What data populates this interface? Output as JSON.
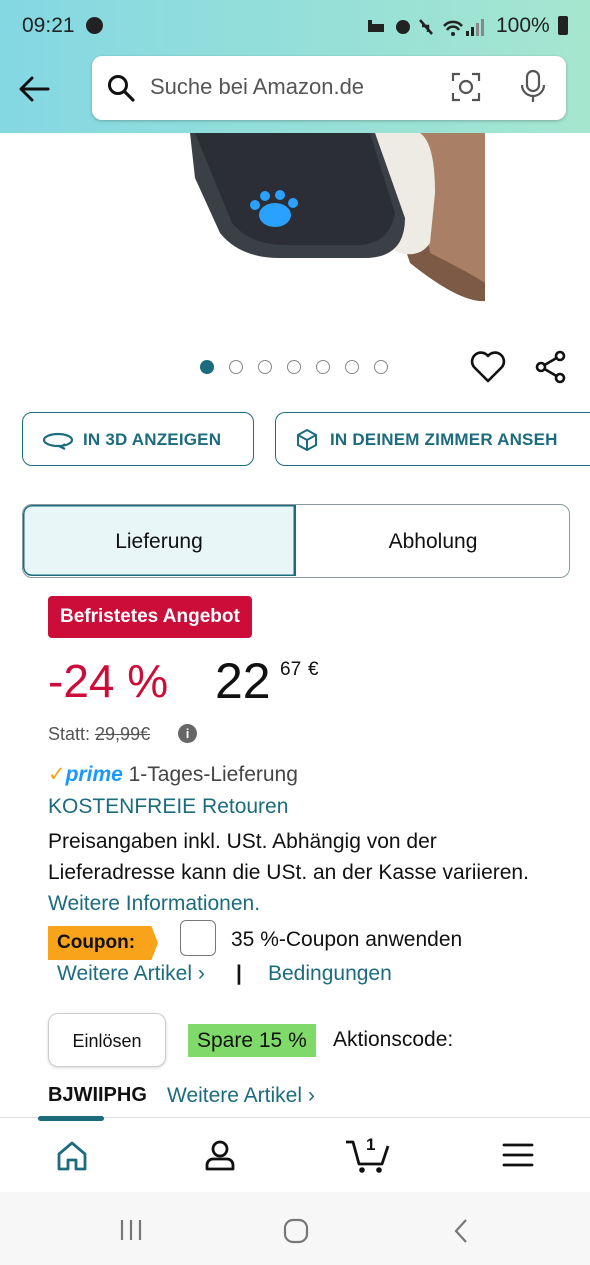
{
  "status_bar": {
    "time": "09:21",
    "battery": "100%"
  },
  "search": {
    "placeholder": "Suche bei Amazon.de"
  },
  "gallery": {
    "image_count": 7,
    "active_index": 0
  },
  "view_buttons": {
    "view_3d": "IN 3D ANZEIGEN",
    "view_room": "IN DEINEM ZIMMER ANSEH"
  },
  "delivery_tabs": {
    "delivery": "Lieferung",
    "pickup": "Abholung"
  },
  "deal": {
    "badge": "Befristetes Angebot",
    "discount": "-24 %",
    "price_whole": "22",
    "price_fraction": "67",
    "currency": "€",
    "was_label": "Statt: ",
    "was_price": "29,99€"
  },
  "shipping": {
    "prime": "prime",
    "prime_delivery": " 1-Tages-Lieferung",
    "returns": "KOSTENFREIE Retouren",
    "tax_note": "Preisangaben inkl. USt. Abhängig von der Lieferadresse kann die USt. an der Kasse variieren. ",
    "more_info": "Weitere Informationen."
  },
  "coupon": {
    "tag": "Coupon:",
    "apply_label": "35 %-Coupon anwenden",
    "more_items": "Weitere Artikel ›",
    "separator": "|",
    "conditions": "Bedingungen"
  },
  "promo": {
    "redeem": "Einlösen",
    "save": "Spare 15 %",
    "code_label": "Aktionscode:",
    "code": "BJWIIPHG",
    "more_items": "Weitere Artikel ›"
  },
  "bottom_nav": {
    "cart_count": "1"
  },
  "colors": {
    "header_start": "#84d8e3",
    "header_end": "#a5e6cf",
    "link_teal": "#1c6c7e",
    "deal_red": "#cc0c39",
    "coupon_orange": "#f8a31a",
    "save_green": "#7fda69",
    "prime_blue": "#1a98ff"
  }
}
